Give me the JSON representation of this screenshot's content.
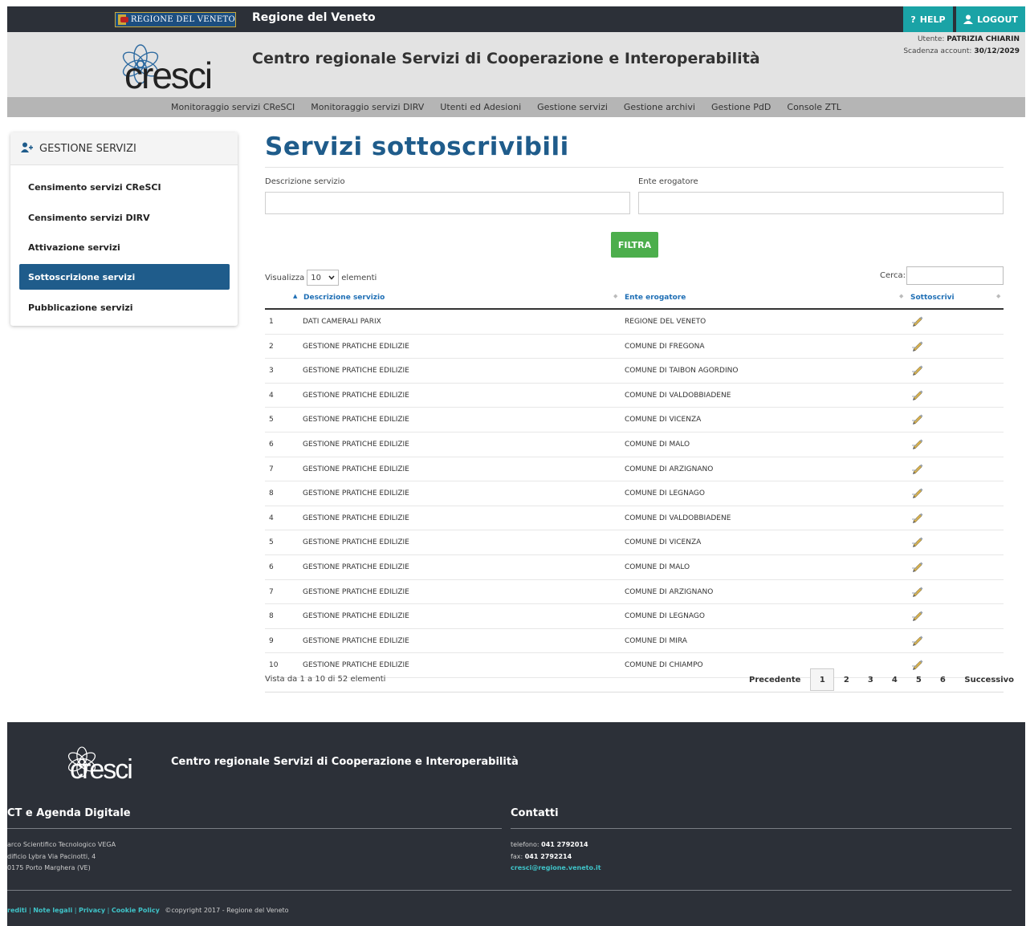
{
  "topbar": {
    "region_logo_text": "REGIONE DEL VENETO",
    "region_title": "Regione del Veneto",
    "help_label": "HELP",
    "logout_label": "LOGOUT"
  },
  "header": {
    "logo_text": "cresci",
    "title": "Centro regionale Servizi di Cooperazione e Interoperabilità",
    "user_label": "Utente:",
    "user_name": "PATRIZIA CHIARIN",
    "expiry_label": "Scadenza account:",
    "expiry_date": "30/12/2029"
  },
  "nav": {
    "items": [
      "Monitoraggio servizi CReSCI",
      "Monitoraggio servizi DIRV",
      "Utenti ed Adesioni",
      "Gestione servizi",
      "Gestione archivi",
      "Gestione PdD",
      "Console ZTL"
    ]
  },
  "sidebar": {
    "title": "GESTIONE SERVIZI",
    "items": [
      "Censimento servizi CReSCI",
      "Censimento servizi DIRV",
      "Attivazione servizi",
      "Sottoscrizione servizi",
      "Pubblicazione servizi"
    ],
    "active_index": 3
  },
  "main": {
    "title": "Servizi sottoscrivibili",
    "filter": {
      "descr_label": "Descrizione servizio",
      "descr_value": "",
      "ente_label": "Ente erogatore",
      "ente_value": "",
      "button_label": "FILTRA"
    },
    "length": {
      "prefix": "Visualizza",
      "value": "10",
      "suffix": "elementi"
    },
    "search_label": "Cerca:",
    "search_value": "",
    "table": {
      "headers": [
        "Descrizione servizio",
        "Ente erogatore",
        "Sottoscrivi"
      ],
      "rows": [
        {
          "n": "1",
          "desc": "DATI CAMERALI PARIX",
          "ente": "REGIONE DEL VENETO"
        },
        {
          "n": "2",
          "desc": "GESTIONE PRATICHE EDILIZIE",
          "ente": "COMUNE DI FREGONA"
        },
        {
          "n": "3",
          "desc": "GESTIONE PRATICHE EDILIZIE",
          "ente": "COMUNE DI TAIBON AGORDINO"
        },
        {
          "n": "4",
          "desc": "GESTIONE PRATICHE EDILIZIE",
          "ente": "COMUNE DI VALDOBBIADENE"
        },
        {
          "n": "5",
          "desc": "GESTIONE PRATICHE EDILIZIE",
          "ente": "COMUNE DI VICENZA"
        },
        {
          "n": "6",
          "desc": "GESTIONE PRATICHE EDILIZIE",
          "ente": "COMUNE DI MALO"
        },
        {
          "n": "7",
          "desc": "GESTIONE PRATICHE EDILIZIE",
          "ente": "COMUNE DI ARZIGNANO"
        },
        {
          "n": "8",
          "desc": "GESTIONE PRATICHE EDILIZIE",
          "ente": "COMUNE DI LEGNAGO"
        },
        {
          "n": "4",
          "desc": "GESTIONE PRATICHE EDILIZIE",
          "ente": "COMUNE DI VALDOBBIADENE"
        },
        {
          "n": "5",
          "desc": "GESTIONE PRATICHE EDILIZIE",
          "ente": "COMUNE DI VICENZA"
        },
        {
          "n": "6",
          "desc": "GESTIONE PRATICHE EDILIZIE",
          "ente": "COMUNE DI MALO"
        },
        {
          "n": "7",
          "desc": "GESTIONE PRATICHE EDILIZIE",
          "ente": "COMUNE DI ARZIGNANO"
        },
        {
          "n": "8",
          "desc": "GESTIONE PRATICHE EDILIZIE",
          "ente": "COMUNE DI LEGNAGO"
        },
        {
          "n": "9",
          "desc": "GESTIONE PRATICHE EDILIZIE",
          "ente": "COMUNE DI MIRA"
        },
        {
          "n": "10",
          "desc": "GESTIONE PRATICHE EDILIZIE",
          "ente": "COMUNE DI CHIAMPO"
        }
      ]
    },
    "info": "Vista da 1 a 10 di 52 elementi",
    "pager": {
      "prev": "Precedente",
      "pages": [
        "1",
        "2",
        "3",
        "4",
        "5",
        "6"
      ],
      "current": "1",
      "next": "Successivo"
    }
  },
  "footer": {
    "logo_text": "cresci",
    "title": "Centro regionale Servizi di Cooperazione e Interoperabilità",
    "left_title": "CT e Agenda Digitale",
    "left_lines": [
      "arco Scientifico Tecnologico VEGA",
      "dificio Lybra Via Pacinotti, 4",
      "0175 Porto Marghera (VE)"
    ],
    "contacts_title": "Contatti",
    "phone_label": "telefono:",
    "phone": "041 2792014",
    "fax_label": "fax:",
    "fax": "041 2792214",
    "email": "cresci@regione.veneto.it",
    "links": [
      "rediti",
      "Note legali",
      "Privacy",
      "Cookie Policy"
    ],
    "copyright": "©copyright 2017 - Regione del Veneto"
  },
  "colors": {
    "dark_bar": "#2c3038",
    "accent_teal": "#1aa3a6",
    "primary_blue": "#1f5c8b",
    "filter_green": "#4cae4c"
  }
}
